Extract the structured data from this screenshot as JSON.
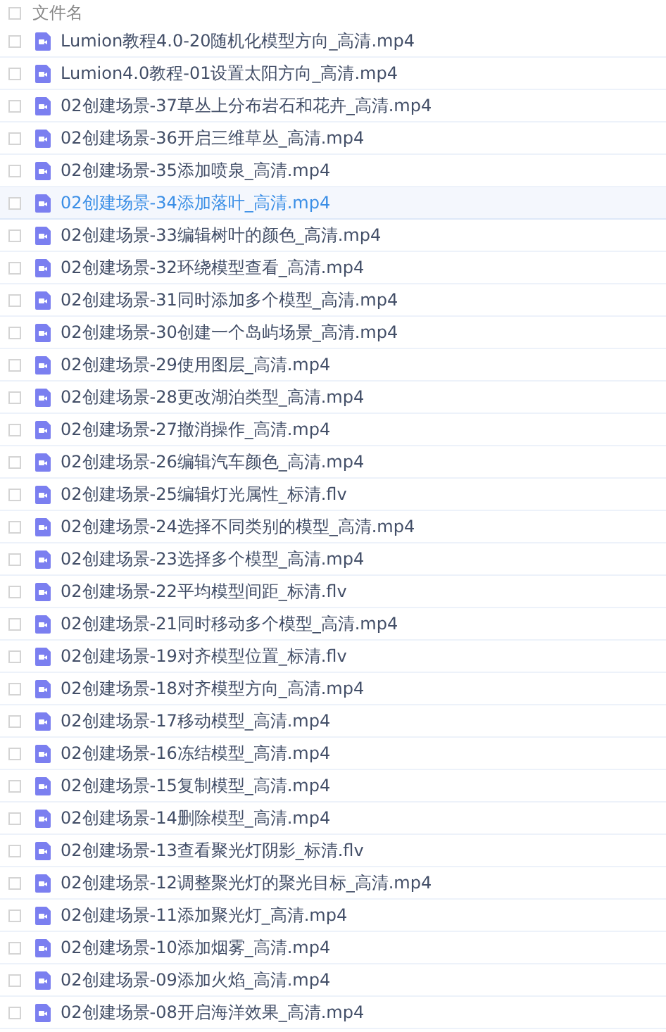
{
  "header": {
    "label": "文件名",
    "checked": false
  },
  "files": [
    {
      "name": "Lumion教程4.0-20随机化模型方向_高清.mp4",
      "checked": false,
      "highlighted": false
    },
    {
      "name": "Lumion4.0教程-01设置太阳方向_高清.mp4",
      "checked": false,
      "highlighted": false
    },
    {
      "name": "02创建场景-37草丛上分布岩石和花卉_高清.mp4",
      "checked": false,
      "highlighted": false
    },
    {
      "name": "02创建场景-36开启三维草丛_高清.mp4",
      "checked": false,
      "highlighted": false
    },
    {
      "name": "02创建场景-35添加喷泉_高清.mp4",
      "checked": false,
      "highlighted": false
    },
    {
      "name": "02创建场景-34添加落叶_高清.mp4",
      "checked": false,
      "highlighted": true
    },
    {
      "name": "02创建场景-33编辑树叶的颜色_高清.mp4",
      "checked": false,
      "highlighted": false
    },
    {
      "name": "02创建场景-32环绕模型查看_高清.mp4",
      "checked": false,
      "highlighted": false
    },
    {
      "name": "02创建场景-31同时添加多个模型_高清.mp4",
      "checked": false,
      "highlighted": false
    },
    {
      "name": "02创建场景-30创建一个岛屿场景_高清.mp4",
      "checked": false,
      "highlighted": false
    },
    {
      "name": "02创建场景-29使用图层_高清.mp4",
      "checked": false,
      "highlighted": false
    },
    {
      "name": "02创建场景-28更改湖泊类型_高清.mp4",
      "checked": false,
      "highlighted": false
    },
    {
      "name": "02创建场景-27撤消操作_高清.mp4",
      "checked": false,
      "highlighted": false
    },
    {
      "name": "02创建场景-26编辑汽车颜色_高清.mp4",
      "checked": false,
      "highlighted": false
    },
    {
      "name": "02创建场景-25编辑灯光属性_标清.flv",
      "checked": false,
      "highlighted": false
    },
    {
      "name": "02创建场景-24选择不同类别的模型_高清.mp4",
      "checked": false,
      "highlighted": false
    },
    {
      "name": "02创建场景-23选择多个模型_高清.mp4",
      "checked": false,
      "highlighted": false
    },
    {
      "name": "02创建场景-22平均模型间距_标清.flv",
      "checked": false,
      "highlighted": false
    },
    {
      "name": "02创建场景-21同时移动多个模型_高清.mp4",
      "checked": false,
      "highlighted": false
    },
    {
      "name": "02创建场景-19对齐模型位置_标清.flv",
      "checked": false,
      "highlighted": false
    },
    {
      "name": "02创建场景-18对齐模型方向_高清.mp4",
      "checked": false,
      "highlighted": false
    },
    {
      "name": "02创建场景-17移动模型_高清.mp4",
      "checked": false,
      "highlighted": false
    },
    {
      "name": "02创建场景-16冻结模型_高清.mp4",
      "checked": false,
      "highlighted": false
    },
    {
      "name": "02创建场景-15复制模型_高清.mp4",
      "checked": false,
      "highlighted": false
    },
    {
      "name": "02创建场景-14删除模型_高清.mp4",
      "checked": false,
      "highlighted": false
    },
    {
      "name": "02创建场景-13查看聚光灯阴影_标清.flv",
      "checked": false,
      "highlighted": false
    },
    {
      "name": "02创建场景-12调整聚光灯的聚光目标_高清.mp4",
      "checked": false,
      "highlighted": false
    },
    {
      "name": "02创建场景-11添加聚光灯_高清.mp4",
      "checked": false,
      "highlighted": false
    },
    {
      "name": "02创建场景-10添加烟雾_高清.mp4",
      "checked": false,
      "highlighted": false
    },
    {
      "name": "02创建场景-09添加火焰_高清.mp4",
      "checked": false,
      "highlighted": false
    },
    {
      "name": "02创建场景-08开启海洋效果_高清.mp4",
      "checked": false,
      "highlighted": false
    }
  ]
}
